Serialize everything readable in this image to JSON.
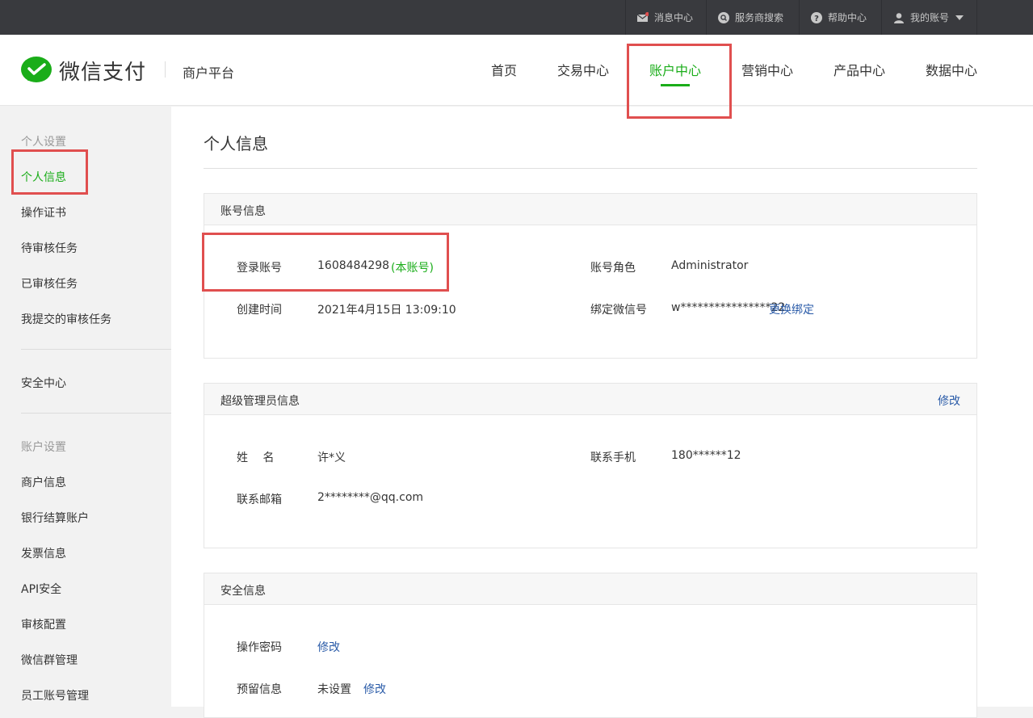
{
  "topbar": {
    "messages": "消息中心",
    "provider_search": "服务商搜索",
    "help": "帮助中心",
    "account": "我的账号"
  },
  "header": {
    "logo_text": "微信支付",
    "platform": "商户平台",
    "nav": [
      "首页",
      "交易中心",
      "账户中心",
      "营销中心",
      "产品中心",
      "数据中心"
    ],
    "active_nav": "账户中心"
  },
  "sidebar": {
    "section1": "个人设置",
    "items1": [
      "个人信息",
      "操作证书",
      "待审核任务",
      "已审核任务",
      "我提交的审核任务"
    ],
    "security": "安全中心",
    "section2": "账户设置",
    "items2": [
      "商户信息",
      "银行结算账户",
      "发票信息",
      "API安全",
      "审核配置",
      "微信群管理",
      "员工账号管理"
    ]
  },
  "main": {
    "title": "个人信息",
    "account_panel": {
      "title": "账号信息",
      "login_label": "登录账号",
      "login_value": "1608484298",
      "login_tag": "(本账号)",
      "role_label": "账号角色",
      "role_value": "Administrator",
      "created_label": "创建时间",
      "created_value": "2021年4月15日 13:09:10",
      "wechat_label": "绑定微信号",
      "wechat_value": "w****************22",
      "wechat_action": "更换绑定"
    },
    "admin_panel": {
      "title": "超级管理员信息",
      "edit": "修改",
      "name_label": "姓　 名",
      "name_value": "许*义",
      "phone_label": "联系手机",
      "phone_value": "180******12",
      "email_label": "联系邮箱",
      "email_value": "2********@qq.com"
    },
    "security_panel": {
      "title": "安全信息",
      "pwd_label": "操作密码",
      "pwd_action": "修改",
      "reserve_label": "预留信息",
      "reserve_value": "未设置",
      "reserve_action": "修改"
    }
  },
  "colors": {
    "accent": "#1aad19",
    "link": "#2a5ba8",
    "highlight": "#e04f4f",
    "topbar": "#393a3e"
  }
}
